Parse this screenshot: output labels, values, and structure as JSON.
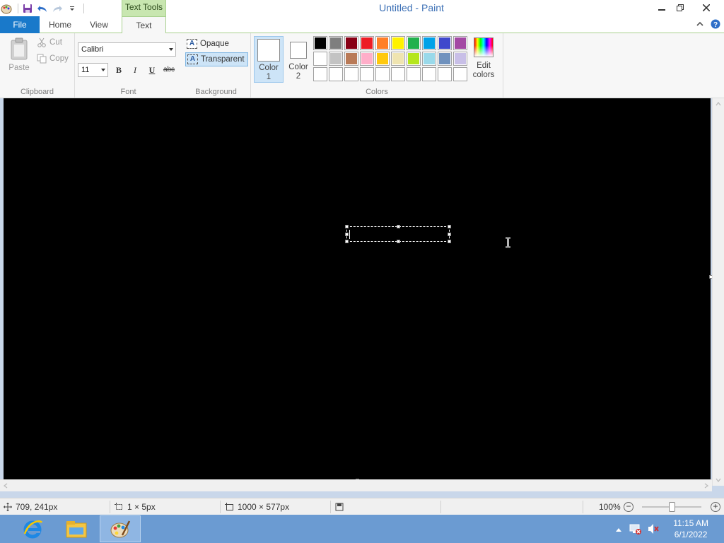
{
  "window": {
    "title": "Untitled - Paint",
    "context_tab": "Text Tools"
  },
  "tabs": {
    "file": "File",
    "home": "Home",
    "view": "View",
    "text": "Text"
  },
  "clipboard": {
    "paste": "Paste",
    "cut": "Cut",
    "copy": "Copy",
    "label": "Clipboard"
  },
  "font": {
    "family": "Calibri",
    "size": "11",
    "bold": "B",
    "italic": "I",
    "underline": "U",
    "strike": "abc",
    "label": "Font"
  },
  "background": {
    "opaque": "Opaque",
    "transparent": "Transparent",
    "label": "Background",
    "icon_letter": "A"
  },
  "colors": {
    "color1_line1": "Color",
    "color1_line2": "1",
    "color2_line1": "Color",
    "color2_line2": "2",
    "edit_line1": "Edit",
    "edit_line2": "colors",
    "label": "Colors",
    "palette": [
      "#000000",
      "#7f7f7f",
      "#880015",
      "#ed1c24",
      "#ff7f27",
      "#fff200",
      "#22b14c",
      "#00a2e8",
      "#3f48cc",
      "#a349a4",
      "#ffffff",
      "#c3c3c3",
      "#b97a57",
      "#ffaec9",
      "#ffc90e",
      "#efe4b0",
      "#b5e61d",
      "#99d9ea",
      "#7092be",
      "#c8bfe7",
      "#ffffff",
      "#ffffff",
      "#ffffff",
      "#ffffff",
      "#ffffff",
      "#ffffff",
      "#ffffff",
      "#ffffff",
      "#ffffff",
      "#ffffff"
    ]
  },
  "status": {
    "cursor_pos": "709, 241px",
    "selection_size": "1 × 5px",
    "image_size": "1000 × 577px",
    "zoom": "100%"
  },
  "taskbar": {
    "time": "11:15 AM",
    "date": "6/1/2022"
  }
}
